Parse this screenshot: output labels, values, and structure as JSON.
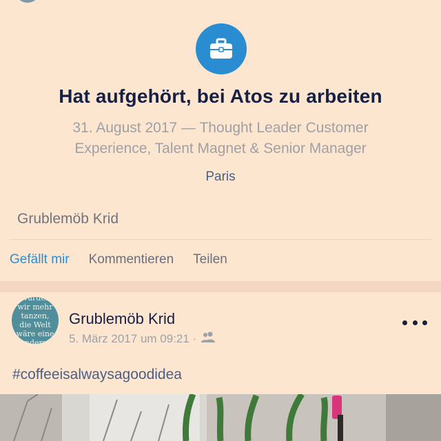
{
  "life_event": {
    "icon": "briefcase-icon",
    "title": "Hat aufgehört, bei Atos zu arbeiten",
    "subtitle_line1": "31. August 2017 — Thought Leader Customer",
    "subtitle_line2": "Experience, Talent Magnet & Senior Manager",
    "location": "Paris",
    "liked_by": "Grublemöb Krid"
  },
  "actions": {
    "like": "Gefällt mir",
    "comment": "Kommentieren",
    "share": "Teilen"
  },
  "post": {
    "author": "Grublemöb Krid",
    "timestamp": "5. März 2017 um 09:21 ·",
    "audience_icon": "friends-icon",
    "avatar_text": [
      "Würden",
      "wir mehr",
      "tanzen,",
      "die Welt",
      "wäre eine",
      "andere!"
    ],
    "text": "#coffeeisalwaysagoodidea"
  },
  "colors": {
    "accent": "#2a8dd2",
    "background": "#fde6d0",
    "title": "#172045",
    "muted": "#9ea0a6"
  }
}
